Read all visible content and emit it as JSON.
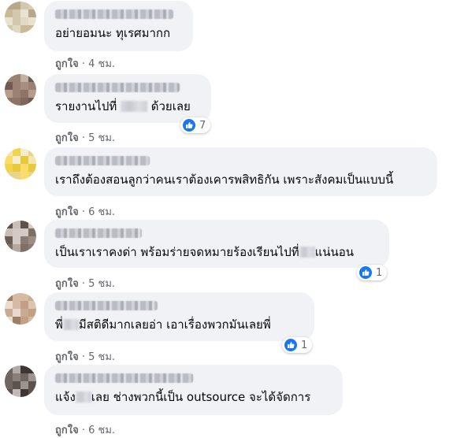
{
  "like_label": "ถูกใจ",
  "separator": "·",
  "colors": {
    "bubble": "#f0f2f5",
    "meta": "#65676b",
    "like_blue": "#1877f2"
  },
  "comments": [
    {
      "text_before": "อย่ายอมนะ ทุเรศมากก",
      "text_after": "",
      "time": "4 ชม.",
      "reactions": null,
      "avatar_icon": "blurred-avatar-icon"
    },
    {
      "text_before": "รายงานไปที่ ",
      "text_after": " ด้วยเลย",
      "time": "5 ชม.",
      "reactions": "7",
      "avatar_icon": "blurred-avatar-icon"
    },
    {
      "text_before": "เราถึงต้องสอนลูกว่าคนเราต้องเคารพสิทธิกัน เพราะสังคมเป็นแบบนี้",
      "text_after": "",
      "time": "6 ชม.",
      "reactions": null,
      "avatar_icon": "blurred-avatar-icon"
    },
    {
      "text_before": "เป็นเราเราคงด่า พร้อมร่ายจดหมายร้องเรียนไปที่",
      "text_after": "แน่นอน",
      "time": "5 ชม.",
      "reactions": "1",
      "avatar_icon": "blurred-avatar-icon"
    },
    {
      "text_before": "พี่",
      "text_after": "มีสติดีมากเลยอ่า เอาเรื่องพวกมันเลยพี่",
      "time": "5 ชม.",
      "reactions": "1",
      "avatar_icon": "blurred-avatar-icon"
    },
    {
      "text_before": "แจ้ง",
      "text_after": "เลย ช่างพวกนี้เป็น outsource จะได้จัดการ",
      "time": "6 ชม.",
      "reactions": null,
      "avatar_icon": "blurred-avatar-icon"
    }
  ]
}
